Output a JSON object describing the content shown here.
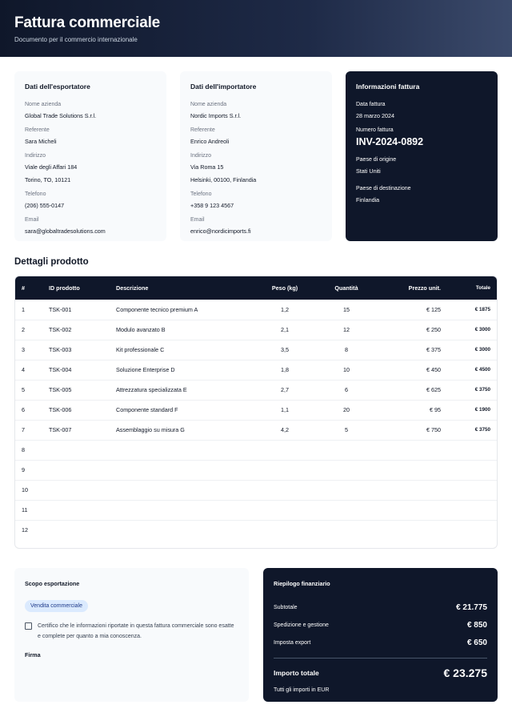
{
  "header": {
    "title": "Fattura commerciale",
    "subtitle": "Documento per il commercio internazionale"
  },
  "exporter": {
    "title": "Dati dell'esportatore",
    "company_label": "Nome azienda",
    "company": "Global Trade Solutions S.r.l.",
    "contact_label": "Referente",
    "contact": "Sara Micheli",
    "address_label": "Indirizzo",
    "address_line1": "Viale degli Affari 184",
    "address_line2": "Torino, TO, 10121",
    "phone_label": "Telefono",
    "phone": "(206) 555-0147",
    "email_label": "Email",
    "email": "sara@globaltradesolutions.com"
  },
  "importer": {
    "title": "Dati dell'importatore",
    "company_label": "Nome azienda",
    "company": "Nordic Imports S.r.l.",
    "contact_label": "Referente",
    "contact": "Enrico Andreoli",
    "address_label": "Indirizzo",
    "address_line1": "Via Roma 15",
    "address_line2": "Helsinki, 00100, Finlandia",
    "phone_label": "Telefono",
    "phone": "+358 9 123 4567",
    "email_label": "Email",
    "email": "enrico@nordicimports.fi"
  },
  "invoice": {
    "title": "Informazioni fattura",
    "date_label": "Data fattura",
    "date": "28 marzo 2024",
    "number_label": "Numero fattura",
    "number": "INV-2024-0892",
    "origin_label": "Paese di origine",
    "origin": "Stati Uniti",
    "destination_label": "Paese di destinazione",
    "destination": "Finlandia"
  },
  "products": {
    "title": "Dettagli prodotto",
    "headers": {
      "num": "#",
      "id": "ID prodotto",
      "desc": "Descrizione",
      "weight": "Peso (kg)",
      "qty": "Quantità",
      "price": "Prezzo unit.",
      "total": "Totale"
    },
    "rows": [
      {
        "num": "1",
        "id": "TSK-001",
        "desc": "Componente tecnico premium A",
        "weight": "1,2",
        "qty": "15",
        "price": "€ 125",
        "total": "€ 1875"
      },
      {
        "num": "2",
        "id": "TSK-002",
        "desc": "Modulo avanzato B",
        "weight": "2,1",
        "qty": "12",
        "price": "€ 250",
        "total": "€ 3000"
      },
      {
        "num": "3",
        "id": "TSK-003",
        "desc": "Kit professionale C",
        "weight": "3,5",
        "qty": "8",
        "price": "€ 375",
        "total": "€ 3000"
      },
      {
        "num": "4",
        "id": "TSK-004",
        "desc": "Soluzione Enterprise D",
        "weight": "1,8",
        "qty": "10",
        "price": "€ 450",
        "total": "€ 4500"
      },
      {
        "num": "5",
        "id": "TSK-005",
        "desc": "Attrezzatura specializzata E",
        "weight": "2,7",
        "qty": "6",
        "price": "€ 625",
        "total": "€ 3750"
      },
      {
        "num": "6",
        "id": "TSK-006",
        "desc": "Componente standard F",
        "weight": "1,1",
        "qty": "20",
        "price": "€ 95",
        "total": "€ 1900"
      },
      {
        "num": "7",
        "id": "TSK-007",
        "desc": "Assemblaggio su misura G",
        "weight": "4,2",
        "qty": "5",
        "price": "€ 750",
        "total": "€ 3750"
      },
      {
        "num": "8",
        "id": "",
        "desc": "",
        "weight": "",
        "qty": "",
        "price": "",
        "total": ""
      },
      {
        "num": "9",
        "id": "",
        "desc": "",
        "weight": "",
        "qty": "",
        "price": "",
        "total": ""
      },
      {
        "num": "10",
        "id": "",
        "desc": "",
        "weight": "",
        "qty": "",
        "price": "",
        "total": ""
      },
      {
        "num": "11",
        "id": "",
        "desc": "",
        "weight": "",
        "qty": "",
        "price": "",
        "total": ""
      },
      {
        "num": "12",
        "id": "",
        "desc": "",
        "weight": "",
        "qty": "",
        "price": "",
        "total": ""
      }
    ]
  },
  "scope": {
    "title": "Scopo esportazione",
    "badge": "Vendita commerciale",
    "certify_checked": false,
    "certify_text": "Certifico che le informazioni riportate in questa fattura commerciale sono esatte e complete per quanto a mia conoscenza.",
    "signature_label": "Firma"
  },
  "summary": {
    "title": "Riepilogo finanziario",
    "subtotal_label": "Subtotale",
    "subtotal": "€ 21.775",
    "shipping_label": "Spedizione e gestione",
    "shipping": "€ 850",
    "tax_label": "Imposta export",
    "tax": "€ 650",
    "total_label": "Importo totale",
    "total": "€ 23.275",
    "currency_note": "Tutti gli importi in EUR"
  }
}
